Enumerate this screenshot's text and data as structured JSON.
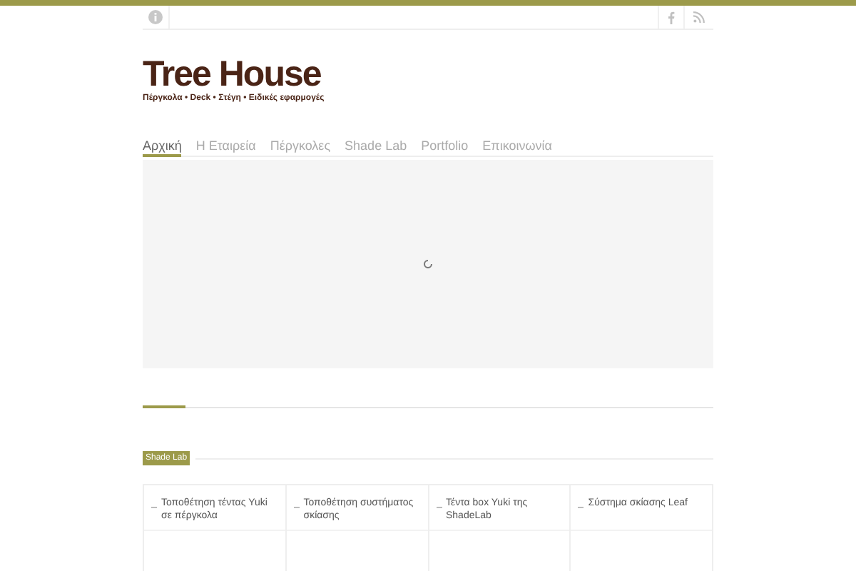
{
  "logo": {
    "title": "Tree House",
    "tagline": "Πέργκολα • Deck • Στέγη • Ειδικές εφαρμογές"
  },
  "nav": [
    {
      "label": "Αρχική",
      "selected": true
    },
    {
      "label": "Η Εταιρεία",
      "selected": false
    },
    {
      "label": "Πέργκολες",
      "selected": false
    },
    {
      "label": "Shade Lab",
      "selected": false
    },
    {
      "label": "Portfolio",
      "selected": false
    },
    {
      "label": "Επικοινωνία",
      "selected": false
    }
  ],
  "section": {
    "badge": "Shade Lab"
  },
  "cards": [
    {
      "title": "Τοποθέτηση τέντας Yuki σε πέργκολα"
    },
    {
      "title": "Τοποθέτηση συστήματος σκίασης"
    },
    {
      "title": "Τέντα box Yuki της ShadeLab"
    },
    {
      "title": "Σύστημα σκίασης Leaf"
    }
  ]
}
